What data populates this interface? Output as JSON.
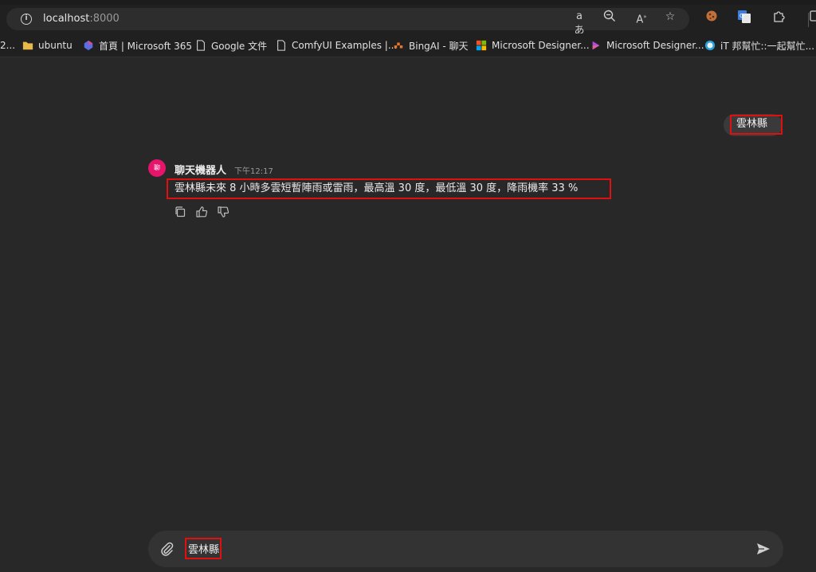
{
  "browser": {
    "url_host": "localhost",
    "url_port": ":8000",
    "toolbar_icons": [
      "read-aloud-icon",
      "zoom-icon",
      "reading-mode-icon",
      "favorite-star-icon",
      "extension-cookie-icon",
      "translate-icon",
      "extensions-puzzle-icon",
      "split-screen-icon"
    ],
    "bookmarks": [
      {
        "label": "2...",
        "icon": "truncated"
      },
      {
        "label": "ubuntu",
        "icon": "folder-icon",
        "color": "#e8b84a"
      },
      {
        "label": "首頁 | Microsoft 365",
        "icon": "m365-icon"
      },
      {
        "label": "Google 文件",
        "icon": "doc-icon"
      },
      {
        "label": "ComfyUI Examples |...",
        "icon": "doc-icon"
      },
      {
        "label": "BingAI - 聊天",
        "icon": "bing-icon"
      },
      {
        "label": "Microsoft Designer...",
        "icon": "microsoft-icon"
      },
      {
        "label": "Microsoft Designer...",
        "icon": "designer-icon"
      },
      {
        "label": "iT 邦幫忙::一起幫忙...",
        "icon": "ithome-icon"
      }
    ]
  },
  "chat": {
    "user_message": "雲林縣",
    "bot_avatar_text": "聊",
    "bot_name": "聊天機器人",
    "bot_time": "下午12:17",
    "bot_message": "雲林縣未來 8 小時多雲短暫陣雨或雷雨，最高溫 30 度，最低溫 30 度，降雨機率 33 %",
    "accent_color": "#e6156c",
    "highlight_color": "#e01010"
  },
  "composer": {
    "input_value": "雲林縣"
  }
}
